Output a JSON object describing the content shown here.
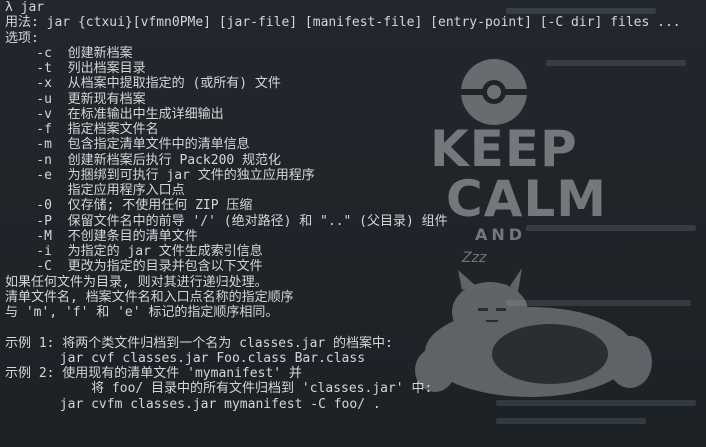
{
  "terminal": {
    "lines": [
      "λ jar",
      "用法: jar {ctxui}[vfmn0PMe] [jar-file] [manifest-file] [entry-point] [-C dir] files ...",
      "选项:",
      "    -c  创建新档案",
      "    -t  列出档案目录",
      "    -x  从档案中提取指定的 (或所有) 文件",
      "    -u  更新现有档案",
      "    -v  在标准输出中生成详细输出",
      "    -f  指定档案文件名",
      "    -m  包含指定清单文件中的清单信息",
      "    -n  创建新档案后执行 Pack200 规范化",
      "    -e  为捆绑到可执行 jar 文件的独立应用程序",
      "        指定应用程序入口点",
      "    -0  仅存储; 不使用任何 ZIP 压缩",
      "    -P  保留文件名中的前导 '/' (绝对路径) 和 \"..\" (父目录) 组件",
      "    -M  不创建条目的清单文件",
      "    -i  为指定的 jar 文件生成索引信息",
      "    -C  更改为指定的目录并包含以下文件",
      "如果任何文件为目录, 则对其进行递归处理。",
      "清单文件名, 档案文件名和入口点名称的指定顺序",
      "与 'm', 'f' 和 'e' 标记的指定顺序相同。",
      "",
      "示例 1: 将两个类文件归档到一个名为 classes.jar 的档案中:",
      "       jar cvf classes.jar Foo.class Bar.class",
      "示例 2: 使用现有的清单文件 'mymanifest' 并",
      "           将 foo/ 目录中的所有文件归档到 'classes.jar' 中:",
      "       jar cvfm classes.jar mymanifest -C foo/ ."
    ]
  },
  "watermark": {
    "keep": "KEEP",
    "calm": "CALM",
    "and": "AND",
    "zzz": "Zzz",
    "pokeball_icon": "pokeball-icon",
    "snorlax_icon": "snorlax-icon"
  },
  "colors": {
    "background": "#1e2227",
    "text": "#d4d6d8",
    "watermark": "#b9bdc0"
  }
}
